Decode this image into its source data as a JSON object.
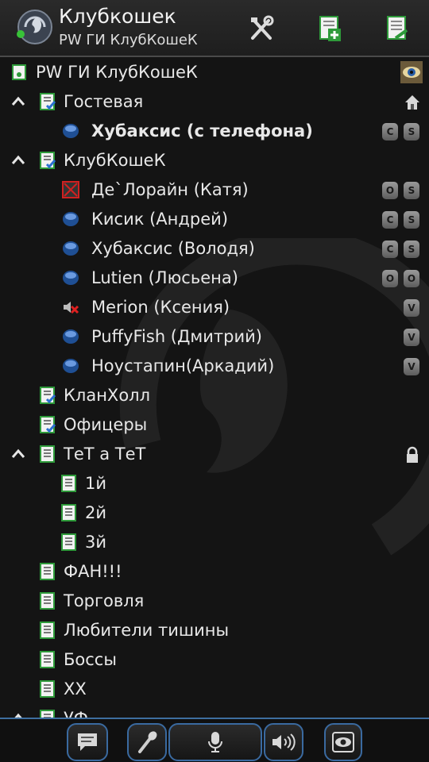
{
  "header": {
    "title": "Клубкошек",
    "subtitle": "PW ГИ КлубКошеК"
  },
  "tree": {
    "server": "PW ГИ КлубКошеК",
    "ch_guest": "Гостевая",
    "u_hubaksis_phone": "Хубаксис (с телефона)",
    "ch_club": "КлубКошеК",
    "u_delorain": "Де`Лорайн (Катя)",
    "u_kisik": "Кисик (Андрей)",
    "u_hubaksis": "Хубаксис (Володя)",
    "u_lutien": "Lutien (Люсьена)",
    "u_merion": "Merion (Ксения)",
    "u_puffy": "PuffyFish (Дмитрий)",
    "u_noustapin": "Ноустапин(Аркадий)",
    "ch_clanhall": "КланХолл",
    "ch_officers": "Офицеры",
    "ch_tet": "ТеТ а ТеТ",
    "ch_1": "1й",
    "ch_2": "2й",
    "ch_3": "3й",
    "ch_fan": "ФАН!!!",
    "ch_trade": "Торговля",
    "ch_silence": "Любители тишины",
    "ch_bosses": "Боссы",
    "ch_xx": "XX",
    "ch_uf": "УФ"
  },
  "badges": {
    "c": "C",
    "s": "S",
    "o": "O",
    "v": "V"
  },
  "icons": {
    "header": [
      "teamspeak-logo",
      "tools-icon",
      "add-channel-icon",
      "edit-channel-icon"
    ],
    "footer": [
      "chat-icon",
      "microphone-icon",
      "push-to-talk-icon",
      "speaker-icon",
      "away-eye-icon"
    ]
  },
  "colors": {
    "accent": "#3a6aa0",
    "channel_icon_green": "#2e9a3a",
    "user_dot_blue": "#2a5fa8"
  }
}
